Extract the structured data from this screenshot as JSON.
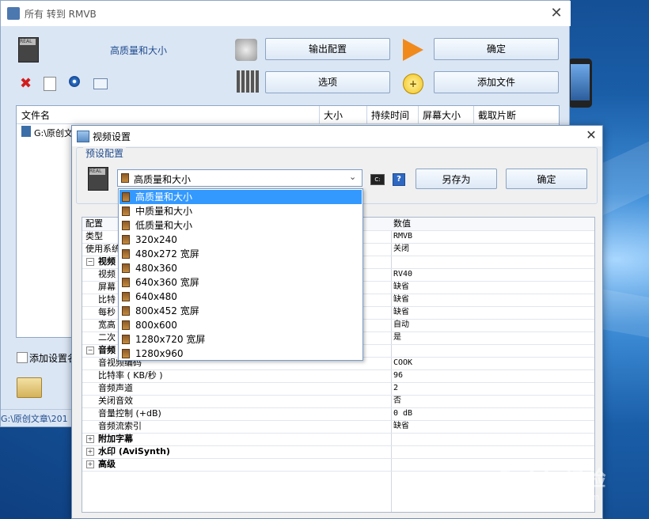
{
  "colors": {
    "accent": "#3399ff",
    "window_bg": "#dbe6f4",
    "dialog_bg": "#f0f0f0"
  },
  "main": {
    "title": "所有 转到 RMVB",
    "preset_label": "高质量和大小",
    "buttons": {
      "output_config": "输出配置",
      "ok": "确定",
      "options": "选项",
      "add_file": "添加文件"
    },
    "filelist": {
      "columns": [
        "文件名",
        "大小",
        "持续时间",
        "屏幕大小",
        "截取片断"
      ],
      "rows": [
        {
          "name": "G:\\原创文"
        }
      ]
    },
    "add_setting_label": "添加设置名",
    "status_path": "G:\\原创文章\\201"
  },
  "dialog": {
    "title": "视频设置",
    "preset_group_label": "预设配置",
    "combo_value": "高质量和大小",
    "buttons": {
      "save_as": "另存为",
      "ok": "确定"
    },
    "help_glyph": "?",
    "dropdown_options": [
      "高质量和大小",
      "中质量和大小",
      "低质量和大小",
      "320x240",
      "480x272 宽屏",
      "480x360",
      "640x360 宽屏",
      "640x480",
      "800x452 宽屏",
      "800x600",
      "1280x720 宽屏",
      "1280x960"
    ],
    "selected_index": 0,
    "grid": {
      "header": {
        "key": "配置",
        "value": "数值"
      },
      "rows": [
        {
          "key": "类型",
          "value": "RMVB",
          "indent": 0,
          "group": false
        },
        {
          "key": "使用系统",
          "value": "关闭",
          "indent": 0,
          "group": false
        },
        {
          "key": "视频",
          "value": "",
          "indent": 0,
          "group": true,
          "expanded": true
        },
        {
          "key": "视频",
          "value": "RV40",
          "indent": 1,
          "group": false
        },
        {
          "key": "屏幕",
          "value": "缺省",
          "indent": 1,
          "group": false
        },
        {
          "key": "比特",
          "value": "缺省",
          "indent": 1,
          "group": false
        },
        {
          "key": "每秒",
          "value": "缺省",
          "indent": 1,
          "group": false
        },
        {
          "key": "宽高",
          "value": "自动",
          "indent": 1,
          "group": false
        },
        {
          "key": "二次",
          "value": "是",
          "indent": 1,
          "group": false
        },
        {
          "key": "音频",
          "value": "",
          "indent": 0,
          "group": true,
          "expanded": true
        },
        {
          "key": "音视频编码",
          "value": "COOK",
          "indent": 1,
          "group": false
        },
        {
          "key": "比特率 ( KB/秒 )",
          "value": "96",
          "indent": 1,
          "group": false
        },
        {
          "key": "音频声道",
          "value": "2",
          "indent": 1,
          "group": false
        },
        {
          "key": "关闭音效",
          "value": "否",
          "indent": 1,
          "group": false
        },
        {
          "key": "音量控制 (+dB)",
          "value": "0 dB",
          "indent": 1,
          "group": false
        },
        {
          "key": "音频流索引",
          "value": "缺省",
          "indent": 1,
          "group": false
        },
        {
          "key": "附加字幕",
          "value": "",
          "indent": 0,
          "group": true,
          "expanded": false
        },
        {
          "key": "水印 (AviSynth)",
          "value": "",
          "indent": 0,
          "group": true,
          "expanded": false
        },
        {
          "key": "高级",
          "value": "",
          "indent": 0,
          "group": true,
          "expanded": false
        }
      ]
    }
  },
  "watermark": {
    "brand": "Baidu经验",
    "url": "jingyan.baidu.com"
  }
}
